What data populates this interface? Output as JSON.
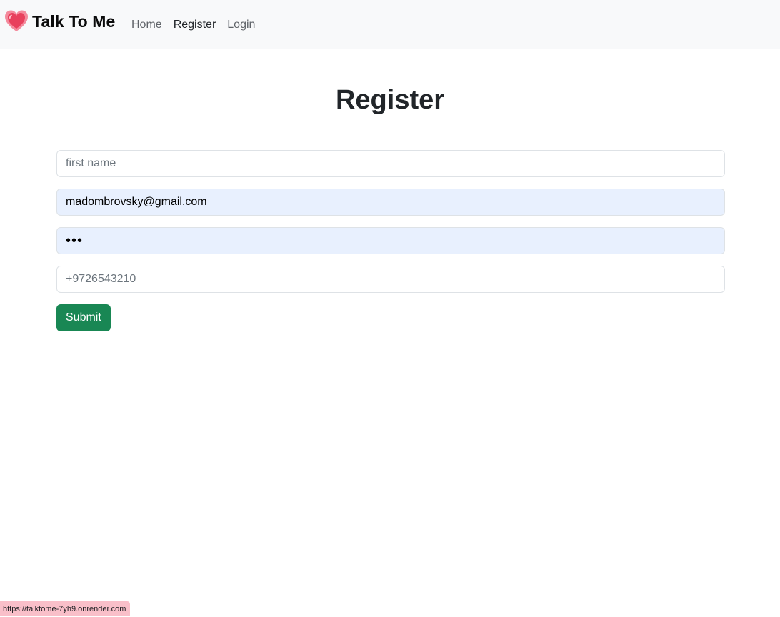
{
  "navbar": {
    "brand_icon": "heart-icon",
    "brand_name": "Talk To Me",
    "links": [
      {
        "label": "Home"
      },
      {
        "label": "Register"
      },
      {
        "label": "Login"
      }
    ]
  },
  "page": {
    "title": "Register"
  },
  "form": {
    "first_name": {
      "placeholder": "first name",
      "value": ""
    },
    "email": {
      "value": "madombrovsky@gmail.com"
    },
    "password": {
      "value": "•••"
    },
    "phone": {
      "placeholder": "+9726543210",
      "value": ""
    },
    "submit_label": "Submit"
  },
  "status_bar": {
    "url": "https://talktome-7yh9.onrender.com"
  },
  "colors": {
    "navbar_bg": "#f8f9fa",
    "submit_bg": "#198754",
    "autofill_bg": "#e8f0fe",
    "status_bar_bg": "#f9bfc9",
    "heart": "#e8415d"
  }
}
